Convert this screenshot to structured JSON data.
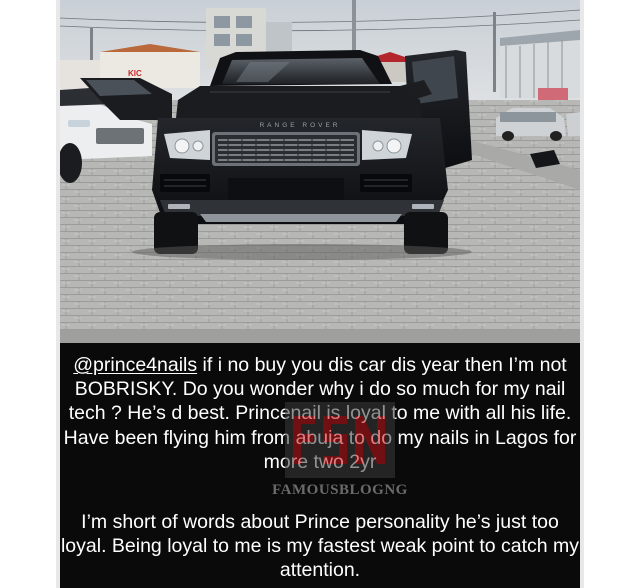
{
  "post": {
    "mention": "@prince4nails",
    "paragraph1_rest": " if i no buy you dis car dis year then I’m not BOBRISKY. Do you wonder why i do so much for my nail tech ? He’s d best. Princenail is loyal to me with all his life. Have been flying him from abuja to do my nails in Lagos for more two 2yr",
    "paragraph2": "I’m short of words about Prince personality he’s just too loyal. Being loyal to me is my fastest weak point to catch my attention."
  },
  "photo": {
    "sign_left": "KIC",
    "grille_lettering": "RANGE ROVER"
  },
  "watermark": {
    "text": "FAMOUSBLOGNG"
  },
  "colors": {
    "caption_background": "#0a0a0a",
    "caption_text": "#ffffff",
    "car_body": "#121418",
    "watermark_red": "#c4161c"
  }
}
